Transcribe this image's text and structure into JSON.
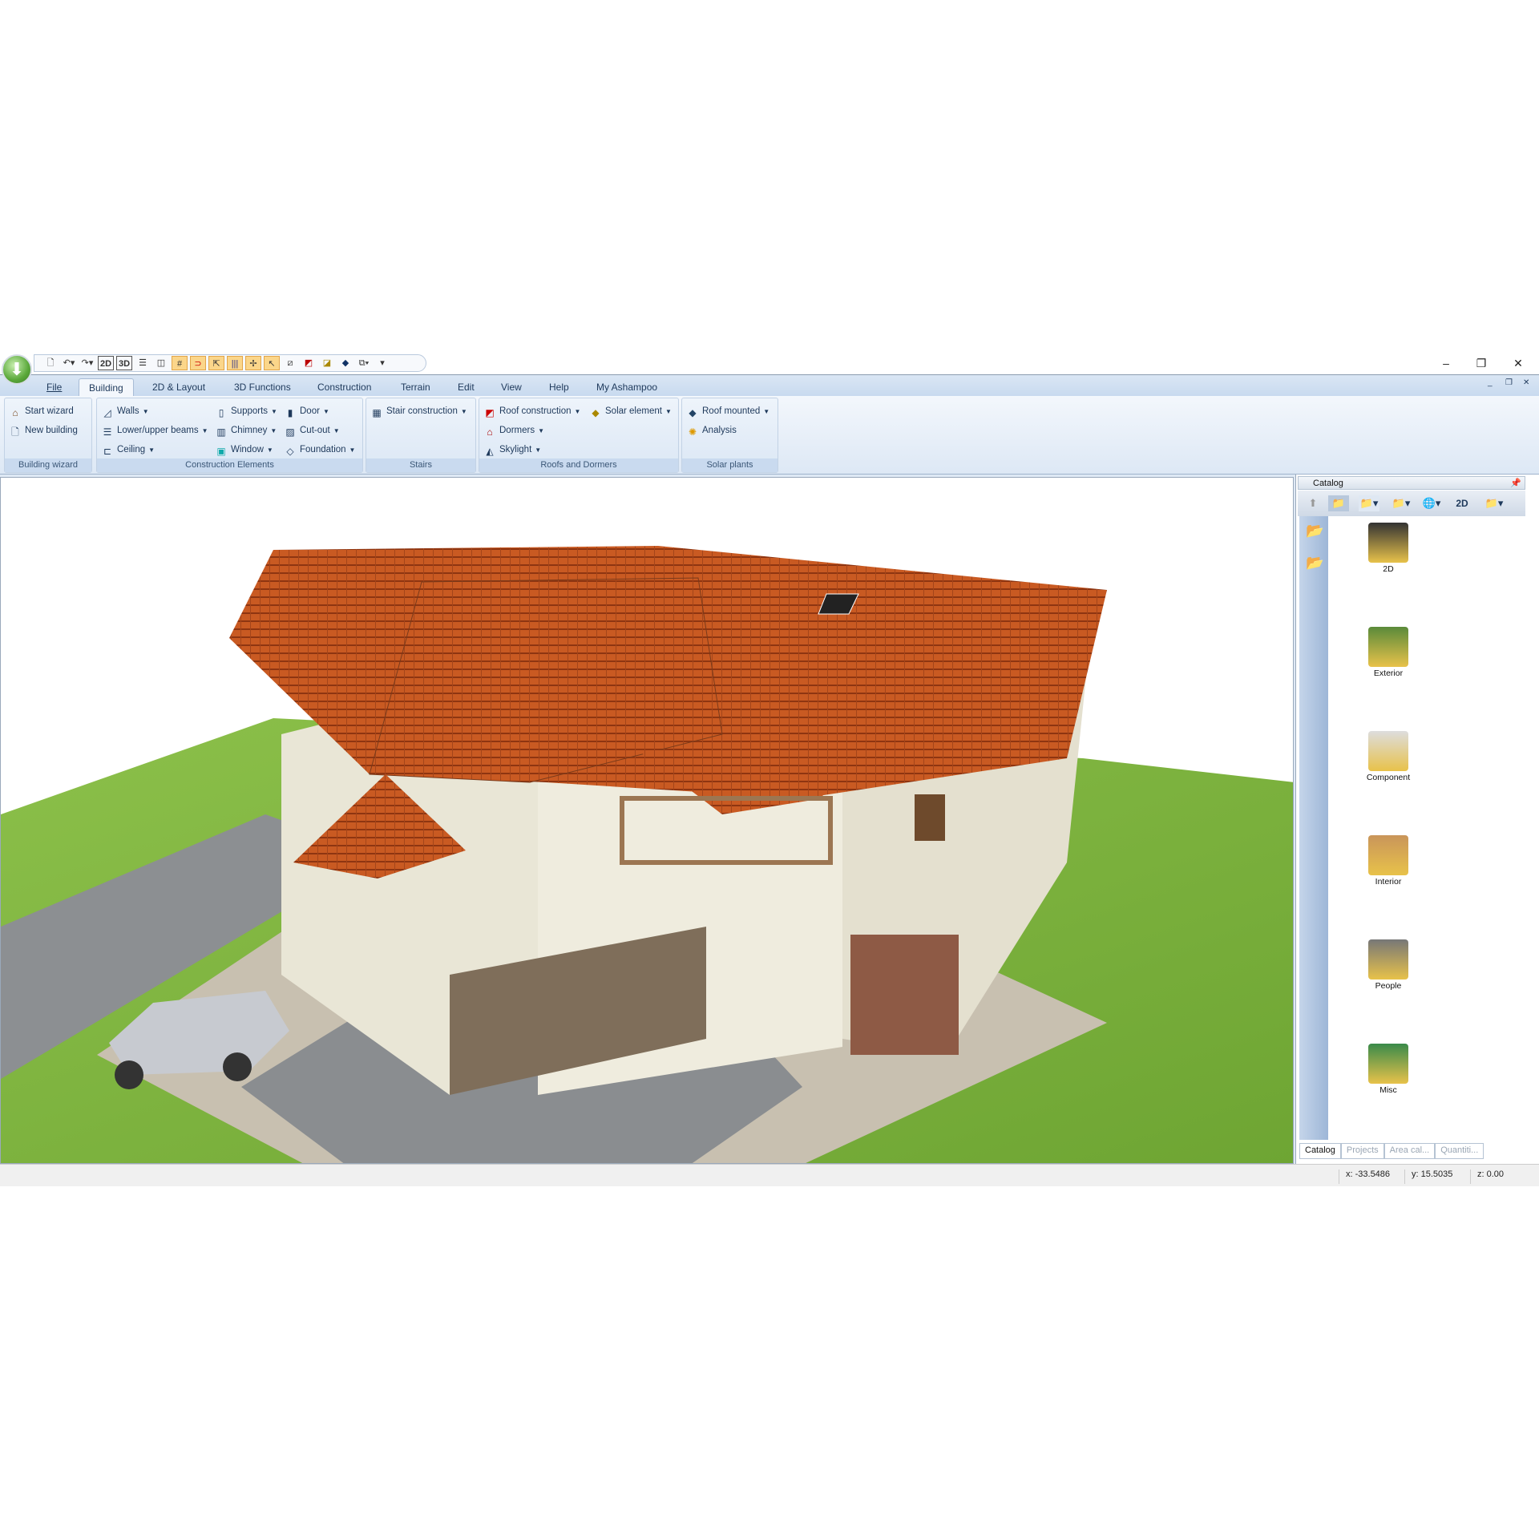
{
  "window": {
    "minimize": "–",
    "restore": "❐",
    "close": "✕",
    "mdi_minimize": "_",
    "mdi_restore": "❐",
    "mdi_close": "✕"
  },
  "quick_access": {
    "icons": [
      "new-document-icon",
      "undo-icon",
      "redo-icon",
      "2d-view-icon",
      "3d-view-icon",
      "horizontal-split-icon",
      "vertical-split-icon",
      "grid-icon",
      "magnet-snap-icon",
      "select-icon",
      "column-icon",
      "snap-point-icon",
      "pointer-icon",
      "delete-element-icon",
      "roof-icon",
      "stairs-icon",
      "material-icon",
      "copy-icon"
    ],
    "labels": {
      "view2d": "2D",
      "view3d": "3D"
    }
  },
  "tabs": [
    "File",
    "Building",
    "2D & Layout",
    "3D Functions",
    "Construction",
    "Terrain",
    "Edit",
    "View",
    "Help",
    "My Ashampoo"
  ],
  "active_tab": "Building",
  "ribbon": {
    "groups": [
      {
        "label": "Building wizard",
        "items": [
          "Start wizard",
          "New building"
        ]
      },
      {
        "label": "Construction Elements",
        "items": [
          "Walls",
          "Lower/upper beams",
          "Ceiling",
          "Supports",
          "Chimney",
          "Window",
          "Door",
          "Cut-out",
          "Foundation"
        ]
      },
      {
        "label": "Stairs",
        "items": [
          "Stair construction"
        ]
      },
      {
        "label": "Roofs and Dormers",
        "items": [
          "Roof construction",
          "Dormers",
          "Skylight",
          "Solar element"
        ]
      },
      {
        "label": "Solar plants",
        "items": [
          "Roof mounted",
          "Analysis"
        ]
      }
    ]
  },
  "catalog": {
    "title": "Catalog",
    "toolbar_2d": "2D",
    "items": [
      "2D",
      "Exterior",
      "Component",
      "Interior",
      "People",
      "Misc"
    ],
    "bottom_tabs": [
      "Catalog",
      "Projects",
      "Area cal...",
      "Quantiti..."
    ]
  },
  "status": {
    "x": "x: -33.5486",
    "y": "y: 15.5035",
    "z": "z: 0.00"
  },
  "colors": {
    "ribbon": "#dde8f5",
    "roof": "#c8541f",
    "wall": "#ece8d6",
    "grass": "#7fb43a",
    "accent": "#1e395b"
  }
}
